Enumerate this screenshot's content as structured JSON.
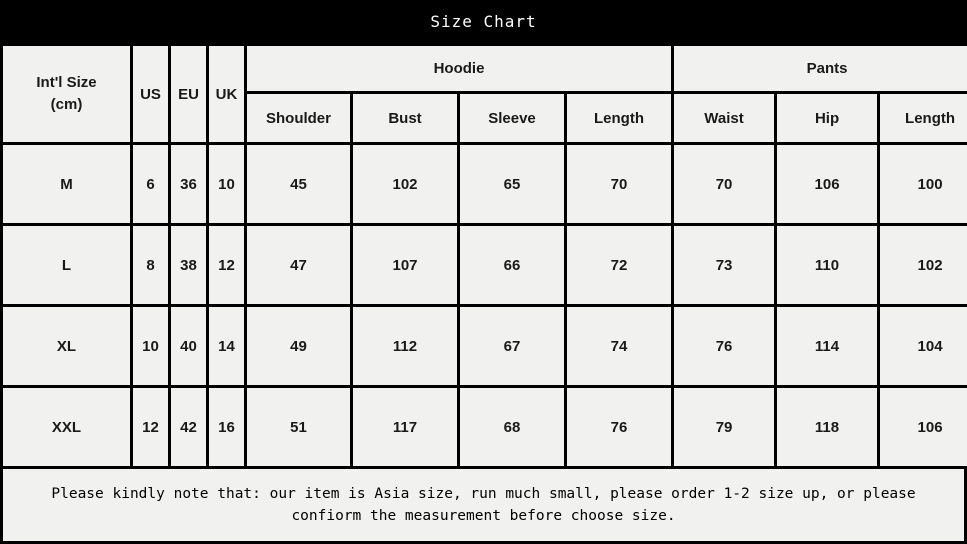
{
  "title": "Size Chart",
  "table": {
    "corner_header": [
      "Int'l Size",
      "(cm)"
    ],
    "standard_headers": [
      "US",
      "EU",
      "UK"
    ],
    "groups": [
      {
        "label": "Hoodie",
        "columns": [
          "Shoulder",
          "Bust",
          "Sleeve",
          "Length"
        ]
      },
      {
        "label": "Pants",
        "columns": [
          "Waist",
          "Hip",
          "Length"
        ]
      }
    ],
    "rows": [
      {
        "size": "M",
        "us": "6",
        "eu": "36",
        "uk": "10",
        "hoodie": {
          "shoulder": "45",
          "bust": "102",
          "sleeve": "65",
          "length": "70"
        },
        "pants": {
          "waist": "70",
          "hip": "106",
          "length": "100"
        }
      },
      {
        "size": "L",
        "us": "8",
        "eu": "38",
        "uk": "12",
        "hoodie": {
          "shoulder": "47",
          "bust": "107",
          "sleeve": "66",
          "length": "72"
        },
        "pants": {
          "waist": "73",
          "hip": "110",
          "length": "102"
        }
      },
      {
        "size": "XL",
        "us": "10",
        "eu": "40",
        "uk": "14",
        "hoodie": {
          "shoulder": "49",
          "bust": "112",
          "sleeve": "67",
          "length": "74"
        },
        "pants": {
          "waist": "76",
          "hip": "114",
          "length": "104"
        }
      },
      {
        "size": "XXL",
        "us": "12",
        "eu": "42",
        "uk": "16",
        "hoodie": {
          "shoulder": "51",
          "bust": "117",
          "sleeve": "68",
          "length": "76"
        },
        "pants": {
          "waist": "79",
          "hip": "118",
          "length": "106"
        }
      }
    ]
  },
  "note": {
    "line1": "Please  kindly note that: our item is Asia size, run much small, please order 1-2 size up, or please",
    "line2": "confiorm the measurement before choose size."
  },
  "colors": {
    "background": "#000000",
    "cell": "#f1f1f0",
    "accent_red": "#d3252a",
    "title_text": "#ffffff",
    "value_text": "#1a1a1a"
  }
}
